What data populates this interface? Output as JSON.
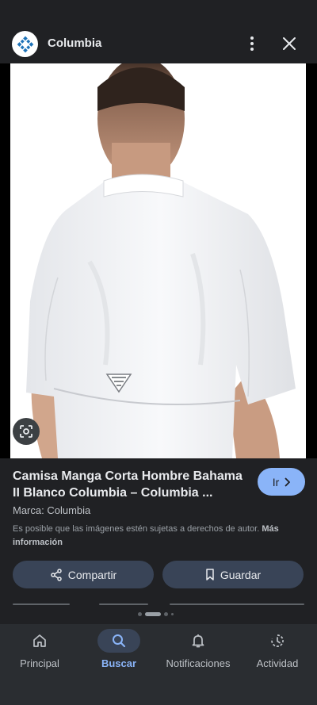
{
  "header": {
    "site_name": "Columbia",
    "logo_icon": "columbia-diamond-logo",
    "more_icon": "more-vert-icon",
    "close_icon": "close-icon"
  },
  "product": {
    "title": "Camisa Manga Corta Hombre Bahama II Blanco Columbia – Columbia ...",
    "go_label": "Ir",
    "brand": "Marca: Columbia",
    "copyright_text": "Es posible que las imágenes estén sujetas a derechos de autor.",
    "copyright_more": "Más información"
  },
  "actions": {
    "share_label": "Compartir",
    "save_label": "Guardar"
  },
  "nav": {
    "items": [
      {
        "label": "Principal",
        "icon": "home-icon"
      },
      {
        "label": "Buscar",
        "icon": "search-icon",
        "active": true
      },
      {
        "label": "Notificaciones",
        "icon": "bell-icon"
      },
      {
        "label": "Actividad",
        "icon": "activity-icon"
      }
    ]
  },
  "colors": {
    "background": "#202124",
    "accent": "#8ab4f8",
    "button": "#394457"
  }
}
